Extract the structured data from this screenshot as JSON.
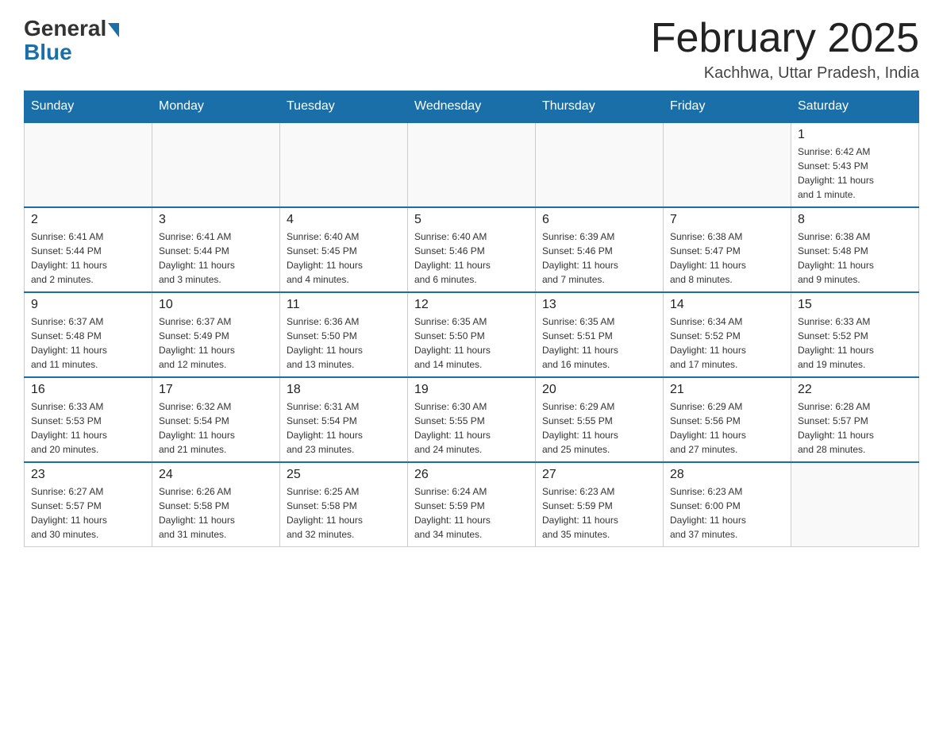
{
  "logo": {
    "general": "General",
    "blue": "Blue"
  },
  "title": "February 2025",
  "location": "Kachhwa, Uttar Pradesh, India",
  "weekdays": [
    "Sunday",
    "Monday",
    "Tuesday",
    "Wednesday",
    "Thursday",
    "Friday",
    "Saturday"
  ],
  "weeks": [
    [
      {
        "day": "",
        "info": ""
      },
      {
        "day": "",
        "info": ""
      },
      {
        "day": "",
        "info": ""
      },
      {
        "day": "",
        "info": ""
      },
      {
        "day": "",
        "info": ""
      },
      {
        "day": "",
        "info": ""
      },
      {
        "day": "1",
        "info": "Sunrise: 6:42 AM\nSunset: 5:43 PM\nDaylight: 11 hours\nand 1 minute."
      }
    ],
    [
      {
        "day": "2",
        "info": "Sunrise: 6:41 AM\nSunset: 5:44 PM\nDaylight: 11 hours\nand 2 minutes."
      },
      {
        "day": "3",
        "info": "Sunrise: 6:41 AM\nSunset: 5:44 PM\nDaylight: 11 hours\nand 3 minutes."
      },
      {
        "day": "4",
        "info": "Sunrise: 6:40 AM\nSunset: 5:45 PM\nDaylight: 11 hours\nand 4 minutes."
      },
      {
        "day": "5",
        "info": "Sunrise: 6:40 AM\nSunset: 5:46 PM\nDaylight: 11 hours\nand 6 minutes."
      },
      {
        "day": "6",
        "info": "Sunrise: 6:39 AM\nSunset: 5:46 PM\nDaylight: 11 hours\nand 7 minutes."
      },
      {
        "day": "7",
        "info": "Sunrise: 6:38 AM\nSunset: 5:47 PM\nDaylight: 11 hours\nand 8 minutes."
      },
      {
        "day": "8",
        "info": "Sunrise: 6:38 AM\nSunset: 5:48 PM\nDaylight: 11 hours\nand 9 minutes."
      }
    ],
    [
      {
        "day": "9",
        "info": "Sunrise: 6:37 AM\nSunset: 5:48 PM\nDaylight: 11 hours\nand 11 minutes."
      },
      {
        "day": "10",
        "info": "Sunrise: 6:37 AM\nSunset: 5:49 PM\nDaylight: 11 hours\nand 12 minutes."
      },
      {
        "day": "11",
        "info": "Sunrise: 6:36 AM\nSunset: 5:50 PM\nDaylight: 11 hours\nand 13 minutes."
      },
      {
        "day": "12",
        "info": "Sunrise: 6:35 AM\nSunset: 5:50 PM\nDaylight: 11 hours\nand 14 minutes."
      },
      {
        "day": "13",
        "info": "Sunrise: 6:35 AM\nSunset: 5:51 PM\nDaylight: 11 hours\nand 16 minutes."
      },
      {
        "day": "14",
        "info": "Sunrise: 6:34 AM\nSunset: 5:52 PM\nDaylight: 11 hours\nand 17 minutes."
      },
      {
        "day": "15",
        "info": "Sunrise: 6:33 AM\nSunset: 5:52 PM\nDaylight: 11 hours\nand 19 minutes."
      }
    ],
    [
      {
        "day": "16",
        "info": "Sunrise: 6:33 AM\nSunset: 5:53 PM\nDaylight: 11 hours\nand 20 minutes."
      },
      {
        "day": "17",
        "info": "Sunrise: 6:32 AM\nSunset: 5:54 PM\nDaylight: 11 hours\nand 21 minutes."
      },
      {
        "day": "18",
        "info": "Sunrise: 6:31 AM\nSunset: 5:54 PM\nDaylight: 11 hours\nand 23 minutes."
      },
      {
        "day": "19",
        "info": "Sunrise: 6:30 AM\nSunset: 5:55 PM\nDaylight: 11 hours\nand 24 minutes."
      },
      {
        "day": "20",
        "info": "Sunrise: 6:29 AM\nSunset: 5:55 PM\nDaylight: 11 hours\nand 25 minutes."
      },
      {
        "day": "21",
        "info": "Sunrise: 6:29 AM\nSunset: 5:56 PM\nDaylight: 11 hours\nand 27 minutes."
      },
      {
        "day": "22",
        "info": "Sunrise: 6:28 AM\nSunset: 5:57 PM\nDaylight: 11 hours\nand 28 minutes."
      }
    ],
    [
      {
        "day": "23",
        "info": "Sunrise: 6:27 AM\nSunset: 5:57 PM\nDaylight: 11 hours\nand 30 minutes."
      },
      {
        "day": "24",
        "info": "Sunrise: 6:26 AM\nSunset: 5:58 PM\nDaylight: 11 hours\nand 31 minutes."
      },
      {
        "day": "25",
        "info": "Sunrise: 6:25 AM\nSunset: 5:58 PM\nDaylight: 11 hours\nand 32 minutes."
      },
      {
        "day": "26",
        "info": "Sunrise: 6:24 AM\nSunset: 5:59 PM\nDaylight: 11 hours\nand 34 minutes."
      },
      {
        "day": "27",
        "info": "Sunrise: 6:23 AM\nSunset: 5:59 PM\nDaylight: 11 hours\nand 35 minutes."
      },
      {
        "day": "28",
        "info": "Sunrise: 6:23 AM\nSunset: 6:00 PM\nDaylight: 11 hours\nand 37 minutes."
      },
      {
        "day": "",
        "info": ""
      }
    ]
  ]
}
